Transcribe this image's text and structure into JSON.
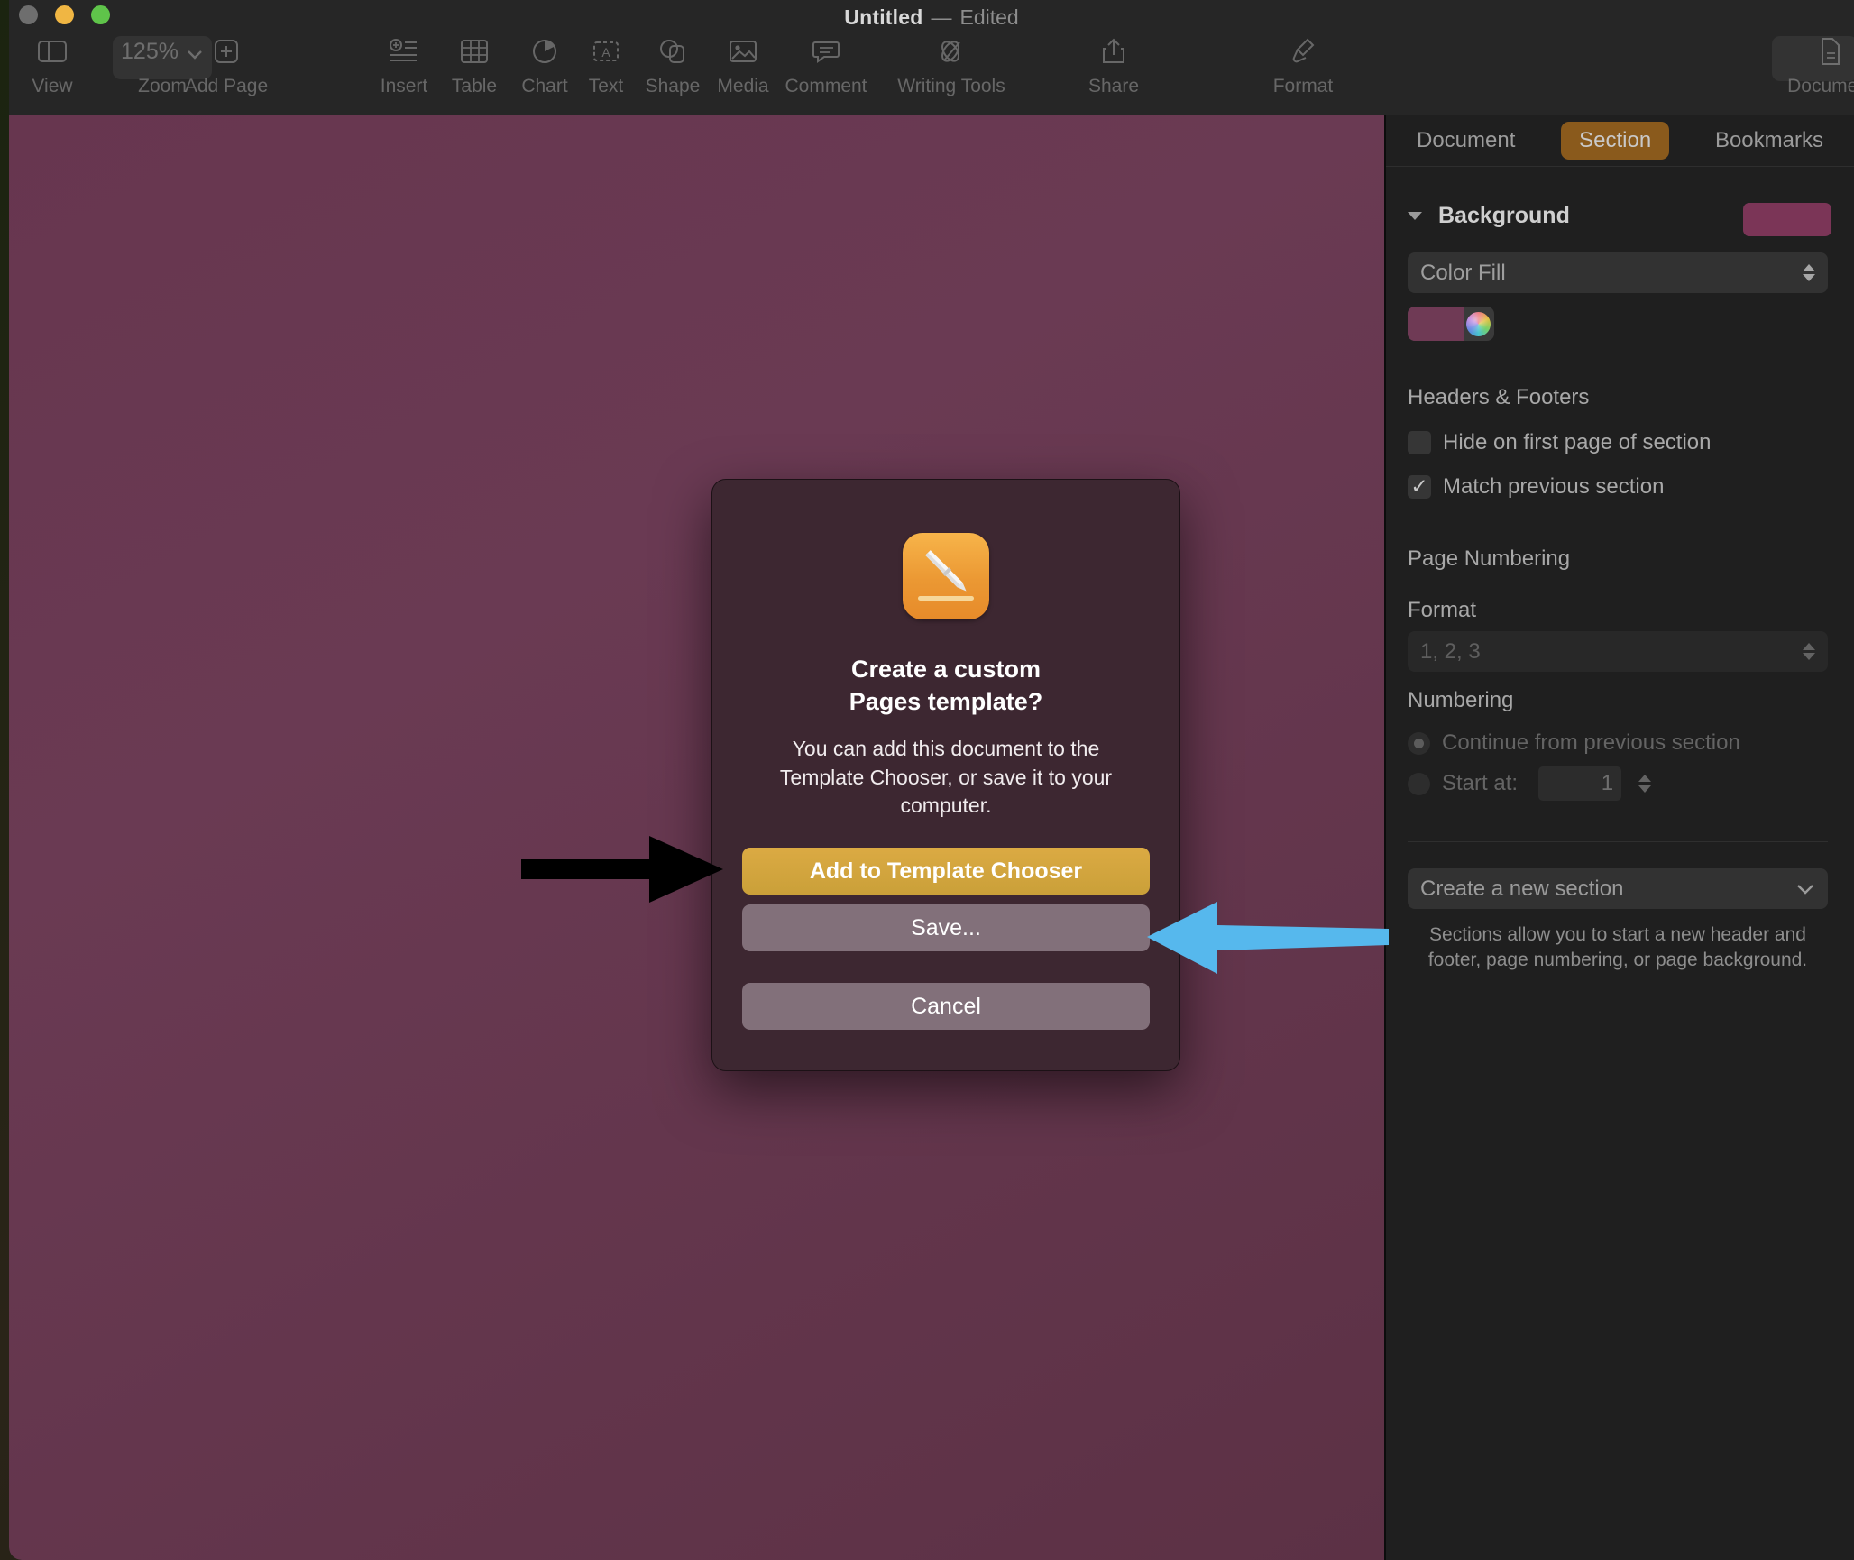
{
  "window": {
    "title": "Untitled",
    "dash": "—",
    "state": "Edited"
  },
  "toolbar": {
    "zoom_value": "125%",
    "items": [
      {
        "label": "View",
        "icon": "sidebar-icon"
      },
      {
        "label": "Zoom",
        "icon": "zoom-chevron-icon"
      },
      {
        "label": "Add Page",
        "icon": "add-page-icon"
      },
      {
        "label": "Insert",
        "icon": "insert-icon"
      },
      {
        "label": "Table",
        "icon": "table-icon"
      },
      {
        "label": "Chart",
        "icon": "chart-icon"
      },
      {
        "label": "Text",
        "icon": "text-box-icon"
      },
      {
        "label": "Shape",
        "icon": "shape-icon"
      },
      {
        "label": "Media",
        "icon": "media-icon"
      },
      {
        "label": "Comment",
        "icon": "comment-icon"
      },
      {
        "label": "Writing Tools",
        "icon": "writing-tools-icon"
      },
      {
        "label": "Share",
        "icon": "share-icon"
      },
      {
        "label": "Format",
        "icon": "format-brush-icon"
      },
      {
        "label": "Document",
        "icon": "document-icon"
      }
    ]
  },
  "inspector": {
    "tabs": [
      {
        "label": "Document",
        "active": false
      },
      {
        "label": "Section",
        "active": true
      },
      {
        "label": "Bookmarks",
        "active": false
      }
    ],
    "background": {
      "section_label": "Background",
      "fill_type": "Color Fill",
      "chip_color": "#7b3557",
      "swatch_color": "#6f3a55"
    },
    "headers_footers": {
      "heading": "Headers & Footers",
      "hide_first_page_label": "Hide on first page of section",
      "hide_first_page_checked": false,
      "match_previous_label": "Match previous section",
      "match_previous_checked": true
    },
    "page_numbering": {
      "heading": "Page Numbering",
      "format_label": "Format",
      "format_value": "1, 2, 3",
      "numbering_label": "Numbering",
      "continue_label": "Continue from previous section",
      "continue_selected": true,
      "start_at_label": "Start at:",
      "start_at_value": "1"
    },
    "new_section": {
      "dropdown_label": "Create a new section",
      "help_text": "Sections allow you to start a new header and footer, page numbering, or page background."
    }
  },
  "dialog": {
    "app_icon_name": "pages-app-icon",
    "title": "Create a custom\nPages template?",
    "title_line1": "Create a custom",
    "title_line2": "Pages template?",
    "body": "You can add this document to the Template Chooser, or save it to your computer.",
    "buttons": [
      {
        "label": "Add to Template Chooser",
        "style": "primary"
      },
      {
        "label": "Save...",
        "style": "secondary"
      },
      {
        "label": "Cancel",
        "style": "secondary"
      }
    ]
  },
  "annotations": {
    "black_arrow_color": "#000000",
    "black_arrow_target": "Add to Template Chooser",
    "blue_arrow_color": "#56b8ed",
    "blue_arrow_target": "Save..."
  }
}
